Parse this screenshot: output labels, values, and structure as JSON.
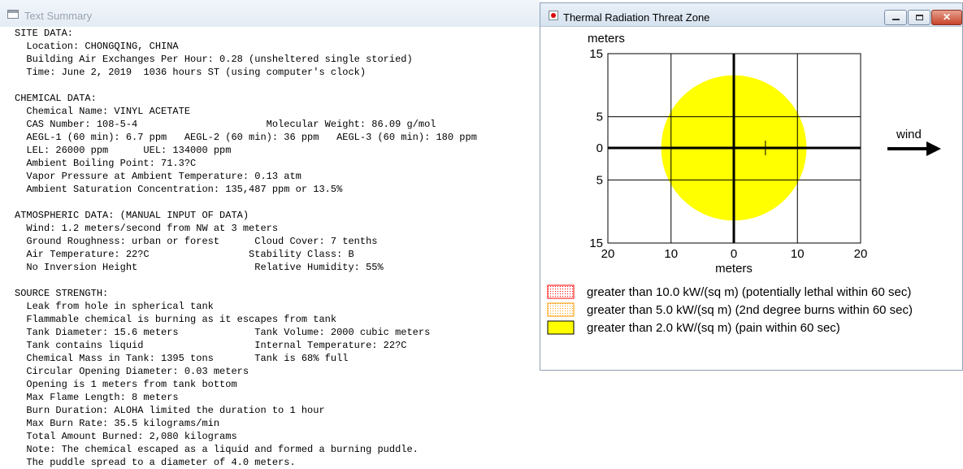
{
  "summary_window": {
    "title": "Text Summary",
    "lines": [
      "SITE DATA:",
      "  Location: CHONGQING, CHINA",
      "  Building Air Exchanges Per Hour: 0.28 (unsheltered single storied)",
      "  Time: June 2, 2019  1036 hours ST (using computer's clock)",
      "",
      "CHEMICAL DATA:",
      "  Chemical Name: VINYL ACETATE",
      "  CAS Number: 108-5-4                      Molecular Weight: 86.09 g/mol",
      "  AEGL-1 (60 min): 6.7 ppm   AEGL-2 (60 min): 36 ppm   AEGL-3 (60 min): 180 ppm",
      "  LEL: 26000 ppm      UEL: 134000 ppm",
      "  Ambient Boiling Point: 71.3?C",
      "  Vapor Pressure at Ambient Temperature: 0.13 atm",
      "  Ambient Saturation Concentration: 135,487 ppm or 13.5%",
      "",
      "ATMOSPHERIC DATA: (MANUAL INPUT OF DATA)",
      "  Wind: 1.2 meters/second from NW at 3 meters",
      "  Ground Roughness: urban or forest      Cloud Cover: 7 tenths",
      "  Air Temperature: 22?C                 Stability Class: B",
      "  No Inversion Height                    Relative Humidity: 55%",
      "",
      "SOURCE STRENGTH:",
      "  Leak from hole in spherical tank",
      "  Flammable chemical is burning as it escapes from tank",
      "  Tank Diameter: 15.6 meters             Tank Volume: 2000 cubic meters",
      "  Tank contains liquid                   Internal Temperature: 22?C",
      "  Chemical Mass in Tank: 1395 tons       Tank is 68% full",
      "  Circular Opening Diameter: 0.03 meters",
      "  Opening is 1 meters from tank bottom",
      "  Max Flame Length: 8 meters",
      "  Burn Duration: ALOHA limited the duration to 1 hour",
      "  Max Burn Rate: 35.5 kilograms/min",
      "  Total Amount Burned: 2,080 kilograms",
      "  Note: The chemical escaped as a liquid and formed a burning puddle.",
      "  The puddle spread to a diameter of 4.0 meters."
    ]
  },
  "threat_window": {
    "title": "Thermal Radiation Threat Zone",
    "y_axis_label": "meters",
    "x_axis_label": "meters",
    "wind_label": "wind",
    "x_ticks": [
      "20",
      "10",
      "0",
      "10",
      "20"
    ],
    "y_ticks": [
      "15",
      "5",
      "0",
      "5",
      "15"
    ],
    "legend": [
      {
        "label": "greater than 10.0 kW/(sq m) (potentially lethal within 60 sec)",
        "fill": "red-dotted"
      },
      {
        "label": "greater than 5.0 kW/(sq m) (2nd degree burns within 60 sec)",
        "fill": "orange-dotted"
      },
      {
        "label": "greater than 2.0 kW/(sq m) (pain within 60 sec)",
        "fill": "yellow"
      }
    ],
    "zone_radius_m": 11.5,
    "source_marker_xy_m": [
      5,
      0
    ],
    "colors": {
      "yellow_zone": "#ffff00",
      "red_zone": "#ff0000",
      "orange_zone": "#ff9900"
    },
    "controls": {
      "minimize_icon": "minimize-icon",
      "maximize_icon": "maximize-icon",
      "close_icon": "close-icon",
      "close_glyph": "✕"
    }
  }
}
